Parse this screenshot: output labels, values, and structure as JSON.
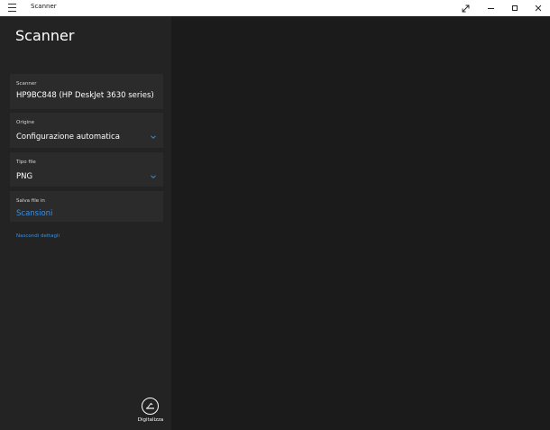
{
  "window": {
    "title": "Scanner"
  },
  "app": {
    "heading": "Scanner"
  },
  "fields": {
    "scanner": {
      "label": "Scanner",
      "value": "HP9BC848 (HP DeskJet 3630 series)"
    },
    "origine": {
      "label": "Origine",
      "value": "Configurazione automatica"
    },
    "tipo_file": {
      "label": "Tipo file",
      "value": "PNG"
    },
    "salva_file": {
      "label": "Salva file in",
      "value": "Scansioni"
    }
  },
  "links": {
    "hide_details": "Nascondi dettagli"
  },
  "actions": {
    "scan_label": "Digitalizza"
  },
  "colors": {
    "accent": "#3b8fe0",
    "panel": "#232323",
    "field_bg": "#2b2b2b",
    "main_bg": "#1b1b1b"
  },
  "icons": {
    "menu": "hamburger-icon",
    "expand": "expand-icon",
    "minimize": "minimize-icon",
    "maximize": "maximize-icon",
    "close": "close-icon",
    "dropdown": "chevron-down-icon",
    "scan": "scan-icon"
  }
}
